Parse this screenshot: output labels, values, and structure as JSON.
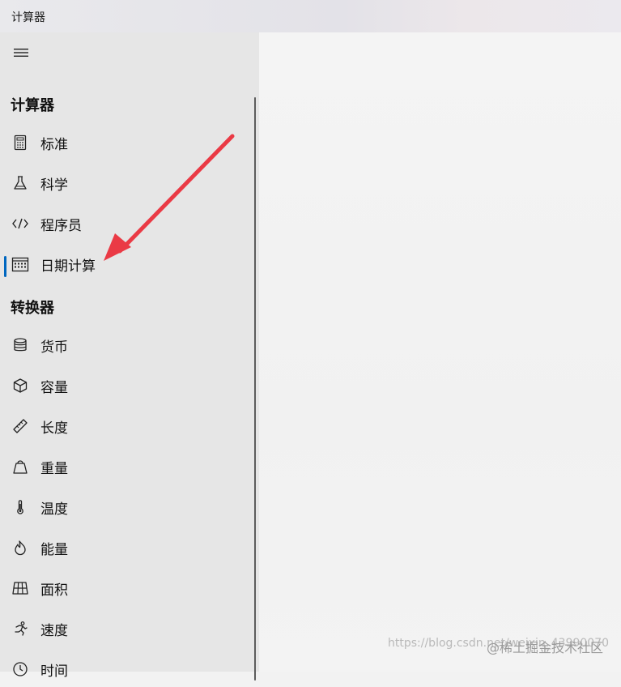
{
  "window": {
    "title": "计算器"
  },
  "nav": {
    "sections": [
      {
        "key": "calculator",
        "header": "计算器"
      },
      {
        "key": "converter",
        "header": "转换器"
      }
    ],
    "items": [
      {
        "label": "标准",
        "icon": "calculator-icon"
      },
      {
        "label": "科学",
        "icon": "flask-icon"
      },
      {
        "label": "程序员",
        "icon": "code-icon"
      },
      {
        "label": "日期计算",
        "icon": "calendar-icon",
        "selected": true
      },
      {
        "label": "货币",
        "icon": "coins-icon"
      },
      {
        "label": "容量",
        "icon": "cube-icon"
      },
      {
        "label": "长度",
        "icon": "ruler-icon"
      },
      {
        "label": "重量",
        "icon": "weight-icon"
      },
      {
        "label": "温度",
        "icon": "thermometer-icon"
      },
      {
        "label": "能量",
        "icon": "flame-icon"
      },
      {
        "label": "面积",
        "icon": "grid-icon"
      },
      {
        "label": "速度",
        "icon": "runner-icon"
      },
      {
        "label": "时间",
        "icon": "clock-icon"
      }
    ]
  },
  "watermark": {
    "text": "https://blog.csdn.net/weixin_43990070",
    "overlay": "@稀土掘金技术社区"
  },
  "colors": {
    "accent": "#0067c0",
    "annotation_arrow": "#ea3a45"
  }
}
